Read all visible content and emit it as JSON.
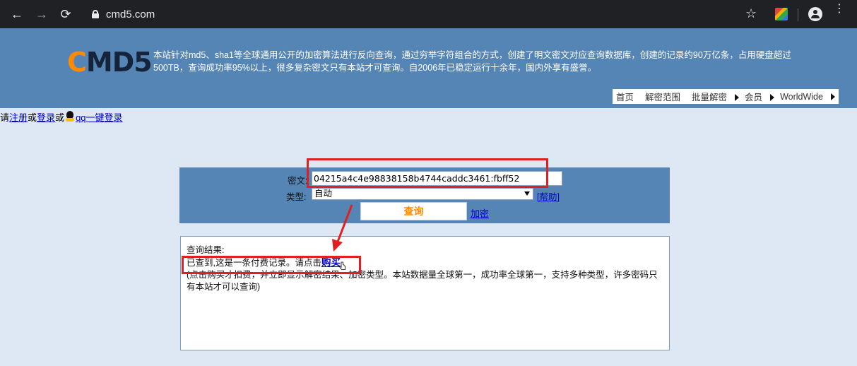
{
  "browser": {
    "url": "cmd5.com",
    "back_icon": "←",
    "forward_icon": "→",
    "reload_icon": "⟳",
    "star_icon": "☆",
    "menu_icon": "⋮"
  },
  "site": {
    "logo_c": "C",
    "logo_rest": "MD5",
    "intro": "本站针对md5、sha1等全球通用公开的加密算法进行反向查询，通过穷举字符组合的方式，创建了明文密文对应查询数据库，创建的记录约90万亿条，占用硬盘超过500TB，查询成功率95%以上，很多复杂密文只有本站才可查询。自2006年已稳定运行十余年，国内外享有盛誉。",
    "nav": [
      {
        "label": "首页",
        "arrow": false
      },
      {
        "label": "解密范围",
        "arrow": false
      },
      {
        "label": "批量解密",
        "arrow": true
      },
      {
        "label": "会员",
        "arrow": true
      },
      {
        "label": "WorldWide",
        "arrow": true
      }
    ],
    "colors": {
      "header_bg": "#5585b5",
      "page_bg": "#dee8f4",
      "logo_accent": "#ff8a00",
      "annotation": "#e02020"
    }
  },
  "login": {
    "prefix": "请",
    "register": "注册",
    "or1": "或",
    "login": "登录",
    "or2": "或",
    "qq_login": "qq一键登录"
  },
  "query": {
    "cipher_label": "密文:",
    "cipher_value": "04215a4c4e98838158b4744caddc3461:fbff52",
    "type_label": "类型:",
    "type_value": "自动",
    "help": "[帮助]",
    "submit": "查询",
    "encrypt_link": "加密"
  },
  "result": {
    "heading": "查询结果:",
    "found_text": "已查到,这是一条付费记录。请点击",
    "buy_link": "购买",
    "note": "(点击购买才扣费，并立即显示解密结果、加密类型。本站数据量全球第一，成功率全球第一，支持多种类型，许多密码只有本站才可以查询)"
  }
}
